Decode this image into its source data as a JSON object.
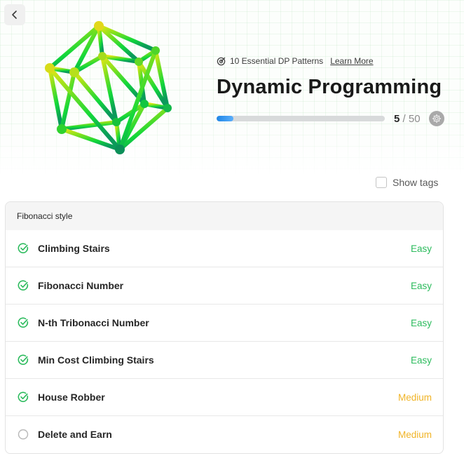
{
  "header": {
    "kicker": "10 Essential DP Patterns",
    "learn_more": "Learn More",
    "title": "Dynamic Programming"
  },
  "progress": {
    "done": "5",
    "separator": "/",
    "total": "50",
    "fraction": 0.1
  },
  "show_tags_label": "Show tags",
  "section": {
    "title": "Fibonacci style",
    "problems": [
      {
        "name": "Climbing Stairs",
        "difficulty": "Easy",
        "solved": true
      },
      {
        "name": "Fibonacci Number",
        "difficulty": "Easy",
        "solved": true
      },
      {
        "name": "N-th Tribonacci Number",
        "difficulty": "Easy",
        "solved": true
      },
      {
        "name": "Min Cost Climbing Stairs",
        "difficulty": "Easy",
        "solved": true
      },
      {
        "name": "House Robber",
        "difficulty": "Medium",
        "solved": true
      },
      {
        "name": "Delete and Earn",
        "difficulty": "Medium",
        "solved": false
      }
    ]
  },
  "colors": {
    "easy": "#2cbb5d",
    "medium": "#f0b427",
    "solved_check": "#2cbb5d",
    "unsolved_circle": "#b8b8b8",
    "progress_fill": "#2a8cf0"
  },
  "icons": {
    "back": "chevron-left-icon",
    "kicker": "target-icon",
    "badge": "gear-badge-icon",
    "solved": "check-circle-icon",
    "unsolved": "empty-circle-icon"
  }
}
